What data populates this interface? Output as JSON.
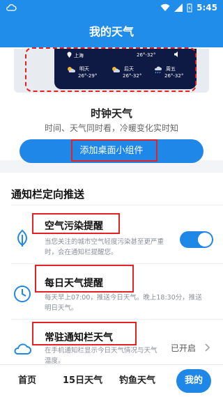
{
  "status": {
    "time": "5:45"
  },
  "header": {
    "title": "我的天气"
  },
  "preview": {
    "city": "上海",
    "temp_range": "26°-32°",
    "days": [
      {
        "label": "明天",
        "temp": "26°-29°"
      },
      {
        "label": "后天",
        "temp": "26°-32°"
      },
      {
        "label": "周五",
        "temp": "26°-32°"
      }
    ]
  },
  "widget": {
    "title": "时钟天气",
    "desc": "时间、天气同时看，冷暖变化实时知",
    "button": "添加桌面小组件"
  },
  "section": {
    "title": "通知栏定向推送",
    "rows": [
      {
        "title": "空气污染提醒",
        "desc": "当您关注的城市空气轻度污染甚至更严重时，会在通知栏提醒您。",
        "toggle_on": true
      },
      {
        "title": "每日天气提醒",
        "desc": "每天早上07:00，推送今日天气。晚上18:30分，推送明日天气。"
      },
      {
        "title": "常驻通知栏天气",
        "desc": "在手机通知栏显示今日天气情况与天气温度。",
        "state": "已开启"
      }
    ]
  },
  "tabs": [
    "首页",
    "15日天气",
    "钓鱼天气",
    "我的"
  ],
  "colors": {
    "primary": "#1e87e8",
    "highlight_box": "#e52020"
  }
}
